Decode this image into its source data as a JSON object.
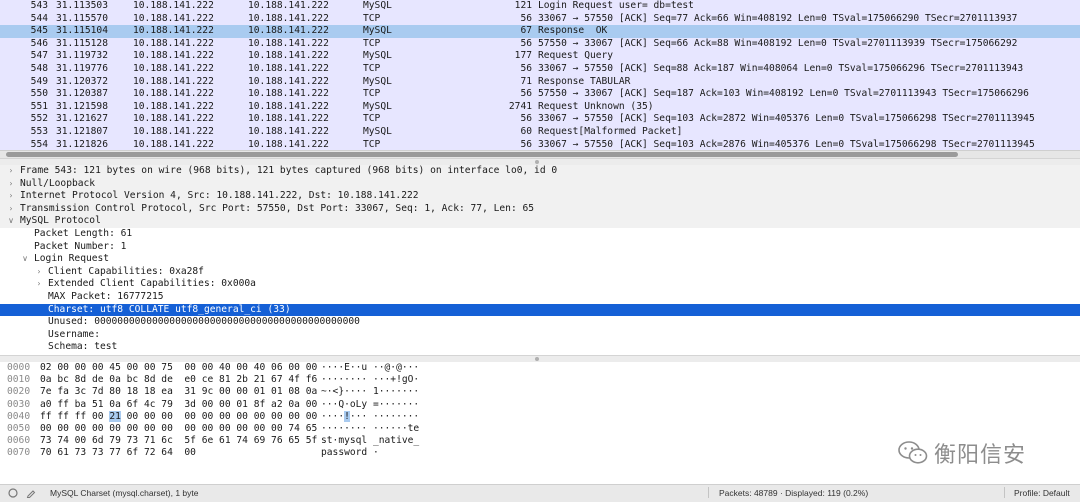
{
  "packet_list": [
    {
      "no": "543",
      "time": "31.113503",
      "src": "10.188.141.222",
      "dst": "10.188.141.222",
      "proto": "MySQL",
      "len": "121",
      "info": "Login Request user= db=test",
      "style": "mysql"
    },
    {
      "no": "544",
      "time": "31.115570",
      "src": "10.188.141.222",
      "dst": "10.188.141.222",
      "proto": "TCP",
      "len": "56",
      "info": "33067 → 57550 [ACK] Seq=77 Ack=66 Win=408192 Len=0 TSval=175066290 TSecr=2701113937",
      "style": "tcp"
    },
    {
      "no": "545",
      "time": "31.115104",
      "src": "10.188.141.222",
      "dst": "10.188.141.222",
      "proto": "MySQL",
      "len": "67",
      "info": "Response  OK",
      "style": "selected"
    },
    {
      "no": "546",
      "time": "31.115128",
      "src": "10.188.141.222",
      "dst": "10.188.141.222",
      "proto": "TCP",
      "len": "56",
      "info": "57550 → 33067 [ACK] Seq=66 Ack=88 Win=408192 Len=0 TSval=2701113939 TSecr=175066292",
      "style": "tcp"
    },
    {
      "no": "547",
      "time": "31.119732",
      "src": "10.188.141.222",
      "dst": "10.188.141.222",
      "proto": "MySQL",
      "len": "177",
      "info": "Request Query",
      "style": "mysql"
    },
    {
      "no": "548",
      "time": "31.119776",
      "src": "10.188.141.222",
      "dst": "10.188.141.222",
      "proto": "TCP",
      "len": "56",
      "info": "33067 → 57550 [ACK] Seq=88 Ack=187 Win=408064 Len=0 TSval=175066296 TSecr=2701113943",
      "style": "tcp"
    },
    {
      "no": "549",
      "time": "31.120372",
      "src": "10.188.141.222",
      "dst": "10.188.141.222",
      "proto": "MySQL",
      "len": "71",
      "info": "Response TABULAR",
      "style": "mysql"
    },
    {
      "no": "550",
      "time": "31.120387",
      "src": "10.188.141.222",
      "dst": "10.188.141.222",
      "proto": "TCP",
      "len": "56",
      "info": "57550 → 33067 [ACK] Seq=187 Ack=103 Win=408192 Len=0 TSval=2701113943 TSecr=175066296",
      "style": "tcp"
    },
    {
      "no": "551",
      "time": "31.121598",
      "src": "10.188.141.222",
      "dst": "10.188.141.222",
      "proto": "MySQL",
      "len": "2741",
      "info": "Request Unknown (35)",
      "style": "mysql"
    },
    {
      "no": "552",
      "time": "31.121627",
      "src": "10.188.141.222",
      "dst": "10.188.141.222",
      "proto": "TCP",
      "len": "56",
      "info": "33067 → 57550 [ACK] Seq=103 Ack=2872 Win=405376 Len=0 TSval=175066298 TSecr=2701113945",
      "style": "tcp"
    },
    {
      "no": "553",
      "time": "31.121807",
      "src": "10.188.141.222",
      "dst": "10.188.141.222",
      "proto": "MySQL",
      "len": "60",
      "info": "Request[Malformed Packet]",
      "style": "mysql"
    },
    {
      "no": "554",
      "time": "31.121826",
      "src": "10.188.141.222",
      "dst": "10.188.141.222",
      "proto": "TCP",
      "len": "56",
      "info": "33067 → 57550 [ACK] Seq=103 Ack=2876 Win=405376 Len=0 TSval=175066298 TSecr=2701113945",
      "style": "tcp"
    }
  ],
  "details": [
    {
      "text": "Frame 543: 121 bytes on wire (968 bits), 121 bytes captured (968 bits) on interface lo0, id 0",
      "level": 0,
      "arrow": "collapsed",
      "style": "top"
    },
    {
      "text": "Null/Loopback",
      "level": 0,
      "arrow": "collapsed",
      "style": "top"
    },
    {
      "text": "Internet Protocol Version 4, Src: 10.188.141.222, Dst: 10.188.141.222",
      "level": 0,
      "arrow": "collapsed",
      "style": "top"
    },
    {
      "text": "Transmission Control Protocol, Src Port: 57550, Dst Port: 33067, Seq: 1, Ack: 77, Len: 65",
      "level": 0,
      "arrow": "collapsed",
      "style": "top"
    },
    {
      "text": "MySQL Protocol",
      "level": 0,
      "arrow": "expanded",
      "style": "top"
    },
    {
      "text": "Packet Length: 61",
      "level": 1,
      "arrow": "none",
      "style": ""
    },
    {
      "text": "Packet Number: 1",
      "level": 1,
      "arrow": "none",
      "style": ""
    },
    {
      "text": "Login Request",
      "level": 1,
      "arrow": "expanded",
      "style": ""
    },
    {
      "text": "Client Capabilities: 0xa28f",
      "level": 2,
      "arrow": "collapsed",
      "style": ""
    },
    {
      "text": "Extended Client Capabilities: 0x000a",
      "level": 2,
      "arrow": "collapsed",
      "style": ""
    },
    {
      "text": "MAX Packet: 16777215",
      "level": 2,
      "arrow": "none",
      "style": ""
    },
    {
      "text": "Charset: utf8 COLLATE utf8_general_ci (33)",
      "level": 2,
      "arrow": "none",
      "style": "selected"
    },
    {
      "text": "Unused: 0000000000000000000000000000000000000000000000",
      "level": 2,
      "arrow": "none",
      "style": ""
    },
    {
      "text": "Username:",
      "level": 2,
      "arrow": "none",
      "style": ""
    },
    {
      "text": "Schema: test",
      "level": 2,
      "arrow": "none",
      "style": ""
    }
  ],
  "hex_rows": [
    {
      "offset": "0000",
      "pre": "02 00 00 00 45 00 00 75  00 00 40 00 40 06 00 00",
      "hl": "",
      "post": "",
      "ascii_pre": "····E··u ··@·@···",
      "ascii_hl": "",
      "ascii_post": ""
    },
    {
      "offset": "0010",
      "pre": "0a bc 8d de 0a bc 8d de  e0 ce 81 2b 21 67 4f f6",
      "hl": "",
      "post": "",
      "ascii_pre": "········ ···+!gO·",
      "ascii_hl": "",
      "ascii_post": ""
    },
    {
      "offset": "0020",
      "pre": "7e fa 3c 7d 80 18 18 ea  31 9c 00 00 01 01 08 0a",
      "hl": "",
      "post": "",
      "ascii_pre": "~·<}···· 1·······",
      "ascii_hl": "",
      "ascii_post": ""
    },
    {
      "offset": "0030",
      "pre": "a0 ff ba 51 0a 6f 4c 79  3d 00 00 01 8f a2 0a 00",
      "hl": "",
      "post": "",
      "ascii_pre": "···Q·oLy =·······",
      "ascii_hl": "",
      "ascii_post": ""
    },
    {
      "offset": "0040",
      "pre": "ff ff ff 00 ",
      "hl": "21",
      "post": " 00 00 00  00 00 00 00 00 00 00 00",
      "ascii_pre": "····",
      "ascii_hl": "!",
      "ascii_post": "··· ········"
    },
    {
      "offset": "0050",
      "pre": "00 00 00 00 00 00 00 00  00 00 00 00 00 00 74 65",
      "hl": "",
      "post": "",
      "ascii_pre": "········ ······te",
      "ascii_hl": "",
      "ascii_post": ""
    },
    {
      "offset": "0060",
      "pre": "73 74 00 6d 79 73 71 6c  5f 6e 61 74 69 76 65 5f",
      "hl": "",
      "post": "",
      "ascii_pre": "st·mysql _native_",
      "ascii_hl": "",
      "ascii_post": ""
    },
    {
      "offset": "0070",
      "pre": "70 61 73 73 77 6f 72 64  00",
      "hl": "",
      "post": "",
      "ascii_pre": "password ·",
      "ascii_hl": "",
      "ascii_post": ""
    }
  ],
  "watermark": {
    "text": "衡阳信安"
  },
  "status": {
    "field": "MySQL Charset (mysql.charset), 1 byte",
    "packets": "Packets: 48789 · Displayed: 119 (0.2%)",
    "profile": "Profile: Default"
  },
  "colors": {
    "selected_row": "#a9cbf0",
    "selected_detail": "#1560d6",
    "protocol_row": "#e7e6ff"
  }
}
